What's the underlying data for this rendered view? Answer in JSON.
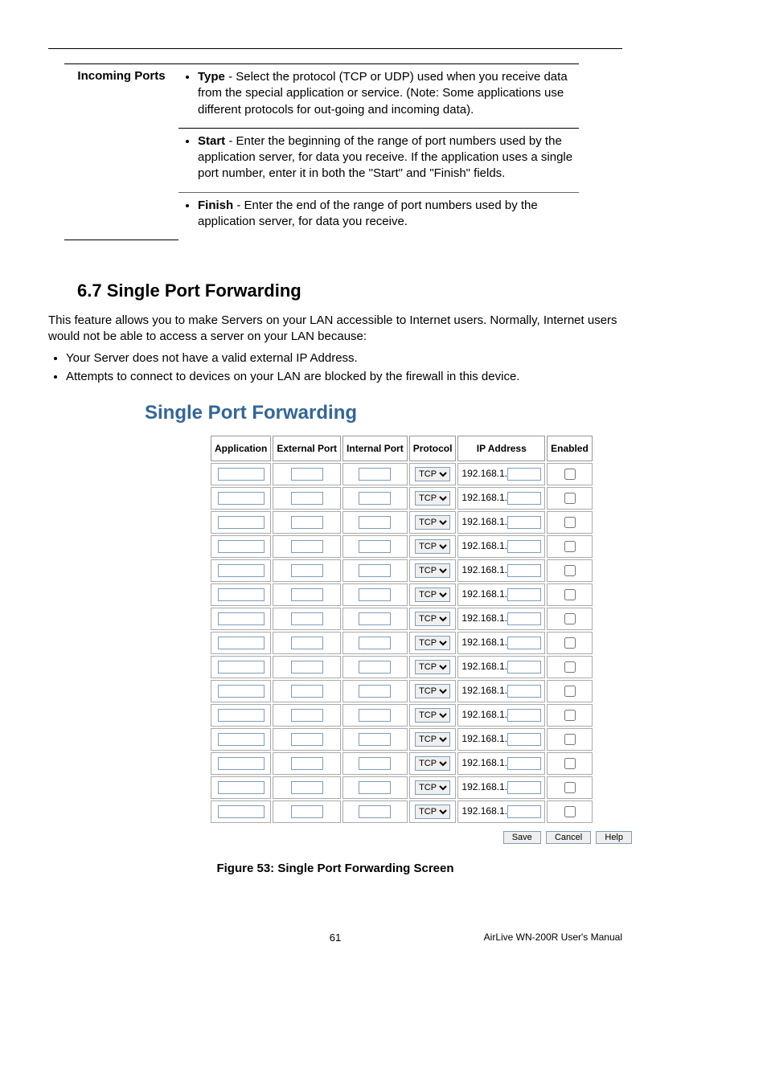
{
  "defTable": {
    "label": "Incoming Ports",
    "items": [
      {
        "term": "Type",
        "text": " - Select the protocol (TCP or UDP) used when you receive data from the special application or service. (Note: Some applications use different protocols for out-going and incoming data)."
      },
      {
        "term": "Start",
        "text": " - Enter the beginning of the range of port numbers used by the application server, for data you receive. If the application uses a single port number, enter it in both the \"Start\" and \"Finish\" fields."
      },
      {
        "term": "Finish",
        "text": " - Enter the end of the range of port numbers used by the application server, for data you receive."
      }
    ]
  },
  "sectionHeading": "6.7  Single Port Forwarding",
  "intro": "This feature allows you to make Servers on your LAN accessible to Internet users. Normally, Internet users would not be able to access a server on your LAN because:",
  "bullets": [
    "Your Server does not have a valid external IP Address.",
    "Attempts to connect to devices on your LAN are blocked by the firewall in this device."
  ],
  "screenTitle": "Single Port Forwarding",
  "tableHeaders": [
    "Application",
    "External Port",
    "Internal Port",
    "Protocol",
    "IP Address",
    "Enabled"
  ],
  "ipPrefix": "192.168.1.",
  "protocolDefault": "TCP",
  "rowCount": 15,
  "buttons": {
    "save": "Save",
    "cancel": "Cancel",
    "help": "Help"
  },
  "figureCaption": "Figure 53: Single Port Forwarding Screen",
  "pageNumber": "61",
  "footerRight": "AirLive WN-200R User's Manual"
}
